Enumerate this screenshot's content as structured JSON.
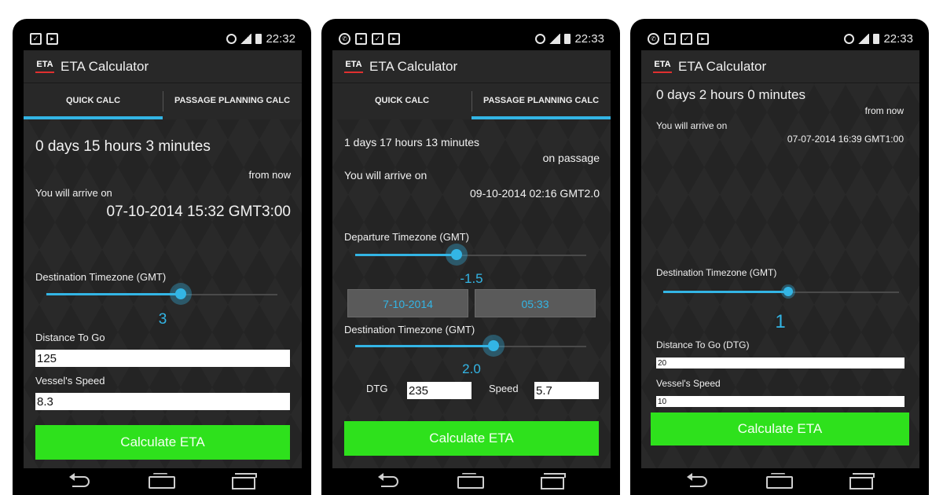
{
  "app": {
    "logo": "ETA",
    "title": "ETA Calculator"
  },
  "tabs": {
    "quick": "QUICK CALC",
    "passage": "PASSAGE PLANNING CALC"
  },
  "nav_icons": [
    "back-icon",
    "home-icon",
    "recent-apps-icon"
  ],
  "colors": {
    "accent": "#33b5e5",
    "button": "#2ee11c",
    "background": "#242424"
  },
  "screen1": {
    "status": {
      "icons": [
        "notification-icon",
        "shopping-bag-icon"
      ],
      "time": "22:32"
    },
    "duration": "0 days 15 hours 3 minutes",
    "from_now": "from now",
    "arrive_label": "You will arrive on",
    "arrive_value": "07-10-2014 15:32 GMT3:00",
    "dest_tz_label": "Destination Timezone (GMT)",
    "dest_tz_value": "3",
    "dest_tz_slider_fraction": 0.58,
    "distance_label": "Distance To Go",
    "distance_value": "125",
    "speed_label": "Vessel's Speed",
    "speed_value": "8.3",
    "calc_button": "Calculate ETA"
  },
  "screen2": {
    "status": {
      "icons": [
        "whatsapp-icon",
        "image-icon",
        "notification-icon",
        "shopping-bag-icon"
      ],
      "time": "22:33"
    },
    "duration": "1 days 17 hours 13 minutes",
    "on_passage": "on passage",
    "arrive_label": "You will arrive on",
    "arrive_value": "09-10-2014 02:16 GMT2.0",
    "dep_tz_label": "Departure Timezone (GMT)",
    "dep_tz_value": "-1.5",
    "dep_tz_slider_fraction": 0.44,
    "date_button": "7-10-2014",
    "time_button": "05:33",
    "dest_tz_label": "Destination Timezone (GMT)",
    "dest_tz_value": "2.0",
    "dest_tz_slider_fraction": 0.6,
    "dtg_label": "DTG",
    "dtg_value": "235",
    "speed_label": "Speed",
    "speed_value": "5.7",
    "calc_button": "Calculate ETA"
  },
  "screen3": {
    "status": {
      "icons": [
        "whatsapp-icon",
        "image-icon",
        "notification-icon",
        "play-store-icon"
      ],
      "time": "22:33"
    },
    "duration": "0 days 2 hours 0 minutes",
    "from_now": "from now",
    "arrive_label": "You will arrive on",
    "arrive_value": "07-07-2014 16:39 GMT1:00",
    "dest_tz_label": "Destination Timezone (GMT)",
    "dest_tz_value": "1",
    "dest_tz_slider_fraction": 0.53,
    "distance_label": "Distance To Go (DTG)",
    "distance_value": "20",
    "speed_label": "Vessel's Speed",
    "speed_value": "10",
    "calc_button": "Calculate ETA"
  }
}
